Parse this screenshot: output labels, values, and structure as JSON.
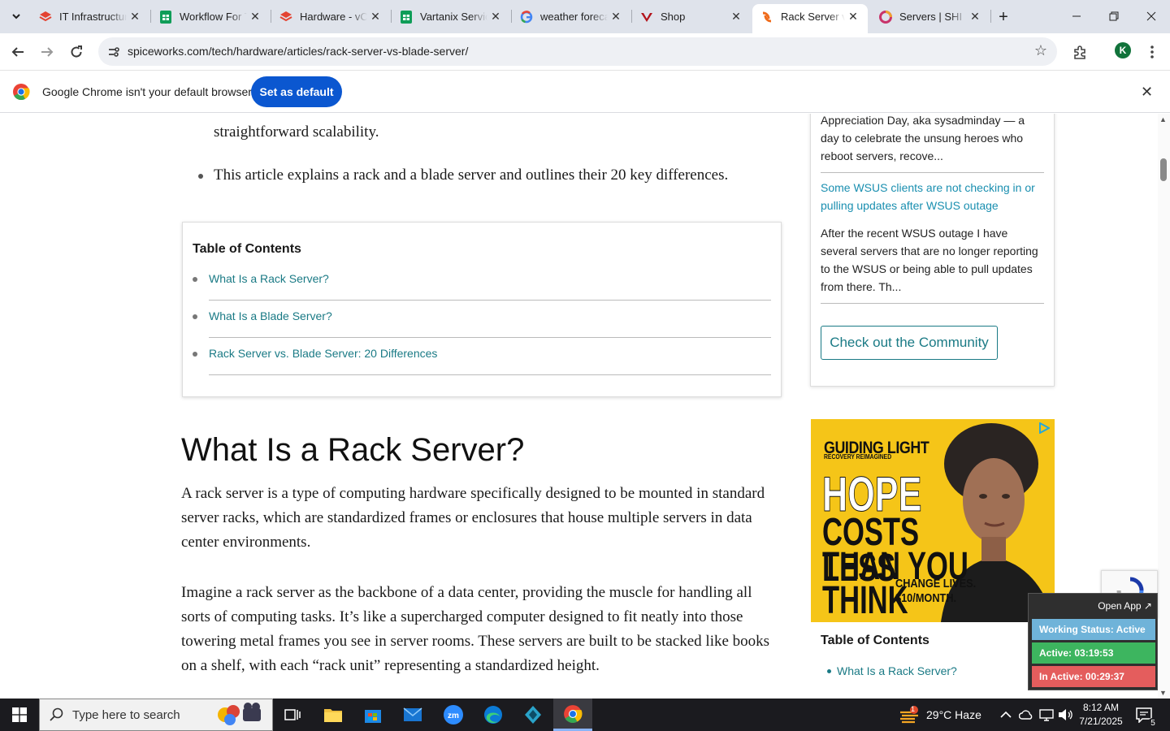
{
  "browser": {
    "tabs": [
      {
        "title": "IT Infrastructure",
        "icon": "todoist-icon",
        "active": false
      },
      {
        "title": "Workflow For Technology",
        "icon": "sheets-icon",
        "active": false
      },
      {
        "title": "Hardware - vCIO",
        "icon": "todoist-icon",
        "active": false
      },
      {
        "title": "Vartanix Services",
        "icon": "sheets-icon",
        "active": false
      },
      {
        "title": "weather forecast",
        "icon": "google-icon",
        "active": false
      },
      {
        "title": "Shop",
        "icon": "v-icon",
        "active": false
      },
      {
        "title": "Rack Server vs",
        "icon": "spiceworks-icon",
        "active": true
      },
      {
        "title": "Servers | SHI",
        "icon": "shi-icon",
        "active": false
      }
    ],
    "url": "spiceworks.com/tech/hardware/articles/rack-server-vs-blade-server/",
    "profile_initial": "K"
  },
  "infobar": {
    "message": "Google Chrome isn't your default browser",
    "button": "Set as default"
  },
  "article": {
    "bullet1_end": "straightforward scalability.",
    "bullet2": "This article explains a rack and a blade server and outlines their 20 key differences.",
    "toc_title": "Table of Contents",
    "toc_items": [
      "What Is a Rack Server?",
      "What Is a Blade Server?",
      "Rack Server vs. Blade Server: 20 Differences"
    ],
    "heading": "What Is a Rack Server?",
    "para1": "A rack server is a type of computing hardware specifically designed to be mounted in standard server racks, which are standardized frames or enclosures that house multiple servers in data center environments.",
    "para2": "Imagine a rack server as the backbone of a data center, providing the muscle for handling all sorts of computing tasks. It’s like a supercharged computer designed to fit neatly into those towering metal frames you see in server rooms. These servers are built to be stacked like books on a shelf, with each “rack unit” representing a standardized height."
  },
  "sidebar": {
    "post1_text": "Appreciation Day, aka sysadminday — a day to celebrate the unsung heroes who reboot servers, recove...",
    "post2_link": "Some WSUS clients are not checking in or pulling updates after WSUS outage",
    "post2_text": "After the recent WSUS outage I have several servers that are no longer reporting to the WSUS or being able to pull updates from there. Th...",
    "community_button": "Check out the Community",
    "toc_title": "Table of Contents",
    "toc_item": "What Is a Rack Server?"
  },
  "ad": {
    "brand": "GUIDING LIGHT",
    "brand_sub": "RECOVERY REIMAGINED",
    "line1": "HOPE",
    "line2": "COSTS LESS",
    "line3": "THAN YOU",
    "line4": "THINK",
    "cta1": "CHANGE LIVES.",
    "cta2": "$10/MONTH."
  },
  "widget": {
    "open_app": "Open App ↗",
    "status": "Working Status: Active",
    "active": "Active: 03:19:53",
    "inactive": "In Active: 00:29:37",
    "colors": {
      "status": "#6fb3d9",
      "active": "#3db55f",
      "inactive": "#e45d5d"
    }
  },
  "taskbar": {
    "search_placeholder": "Type here to search",
    "weather": "29°C  Haze",
    "time": "8:12 AM",
    "date": "7/21/2025",
    "notifications": "5",
    "weather_badge": "1"
  }
}
